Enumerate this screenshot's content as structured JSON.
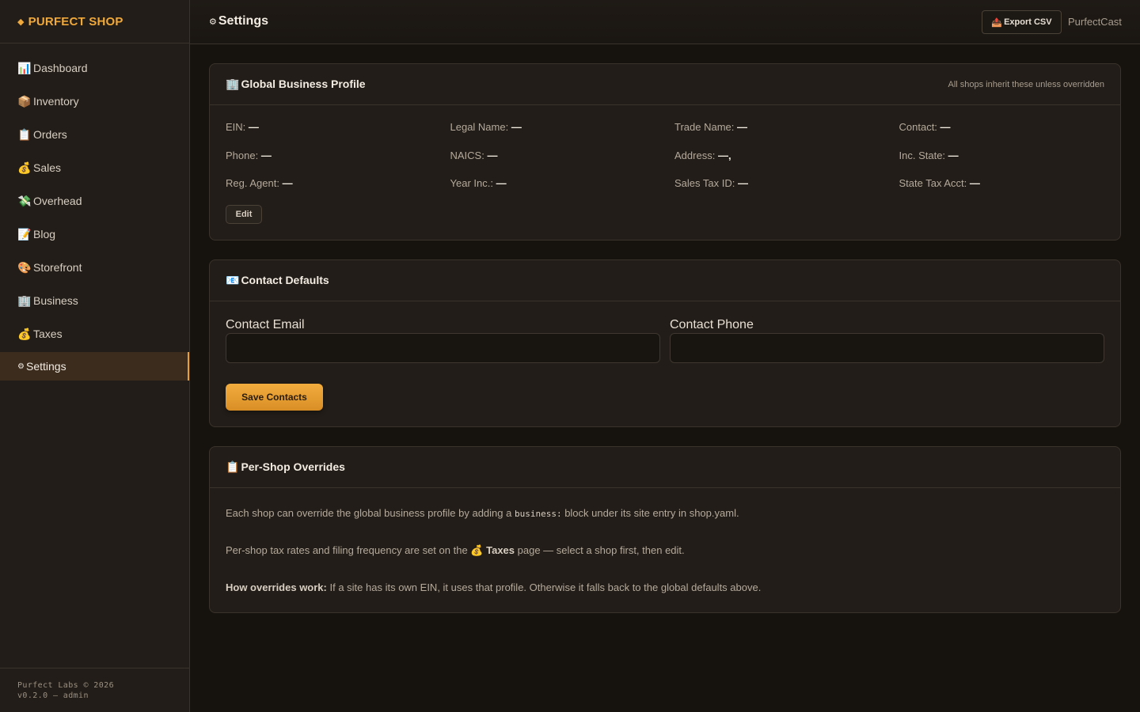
{
  "brand": {
    "icon": "◆",
    "name": "PURFECT SHOP"
  },
  "sidebar": {
    "items": [
      {
        "icon": "📊",
        "label": "Dashboard"
      },
      {
        "icon": "📦",
        "label": "Inventory"
      },
      {
        "icon": "📋",
        "label": "Orders"
      },
      {
        "icon": "💰",
        "label": "Sales"
      },
      {
        "icon": "💸",
        "label": "Overhead"
      },
      {
        "icon": "📝",
        "label": "Blog"
      },
      {
        "icon": "🎨",
        "label": "Storefront"
      },
      {
        "icon": "🏢",
        "label": "Business"
      },
      {
        "icon": "💰",
        "label": "Taxes"
      },
      {
        "icon": "⚙",
        "label": "Settings",
        "active": true
      }
    ],
    "footer_line1": "Purfect Labs © 2026",
    "footer_line2": "v0.2.0 — admin"
  },
  "header": {
    "title_icon": "⚙",
    "title": "Settings",
    "export_icon": "📤",
    "export_label": "Export CSV",
    "user": "PurfectCast"
  },
  "profile": {
    "icon": "🏢",
    "title": "Global Business Profile",
    "note": "All shops inherit these unless overridden",
    "fields": [
      {
        "label": "EIN:",
        "value": "—"
      },
      {
        "label": "Legal Name:",
        "value": "—"
      },
      {
        "label": "Trade Name:",
        "value": "—"
      },
      {
        "label": "Contact:",
        "value": "—"
      },
      {
        "label": "Phone:",
        "value": "—"
      },
      {
        "label": "NAICS:",
        "value": "—"
      },
      {
        "label": "Address:",
        "value": "—,"
      },
      {
        "label": "Inc. State:",
        "value": "—"
      },
      {
        "label": "Reg. Agent:",
        "value": "—"
      },
      {
        "label": "Year Inc.:",
        "value": "—"
      },
      {
        "label": "Sales Tax ID:",
        "value": "—"
      },
      {
        "label": "State Tax Acct:",
        "value": "—"
      }
    ],
    "edit_label": "Edit"
  },
  "contacts": {
    "icon": "📧",
    "title": "Contact Defaults",
    "email_label": "Contact Email",
    "email_value": "",
    "phone_label": "Contact Phone",
    "phone_value": "",
    "save_label": "Save Contacts"
  },
  "overrides": {
    "icon": "📋",
    "title": "Per-Shop Overrides",
    "p1_before": "Each shop can override the global business profile by adding a ",
    "p1_code": "business:",
    "p1_after": " block under its site entry in shop.yaml.",
    "p2_before": "Per-shop tax rates and filing frequency are set on the ",
    "p2_icon": "💰",
    "p2_bold": "Taxes",
    "p2_after": " page — select a shop first, then edit.",
    "p3_bold": "How overrides work:",
    "p3_after": " If a site has its own EIN, it uses that profile. Otherwise it falls back to the global defaults above."
  }
}
